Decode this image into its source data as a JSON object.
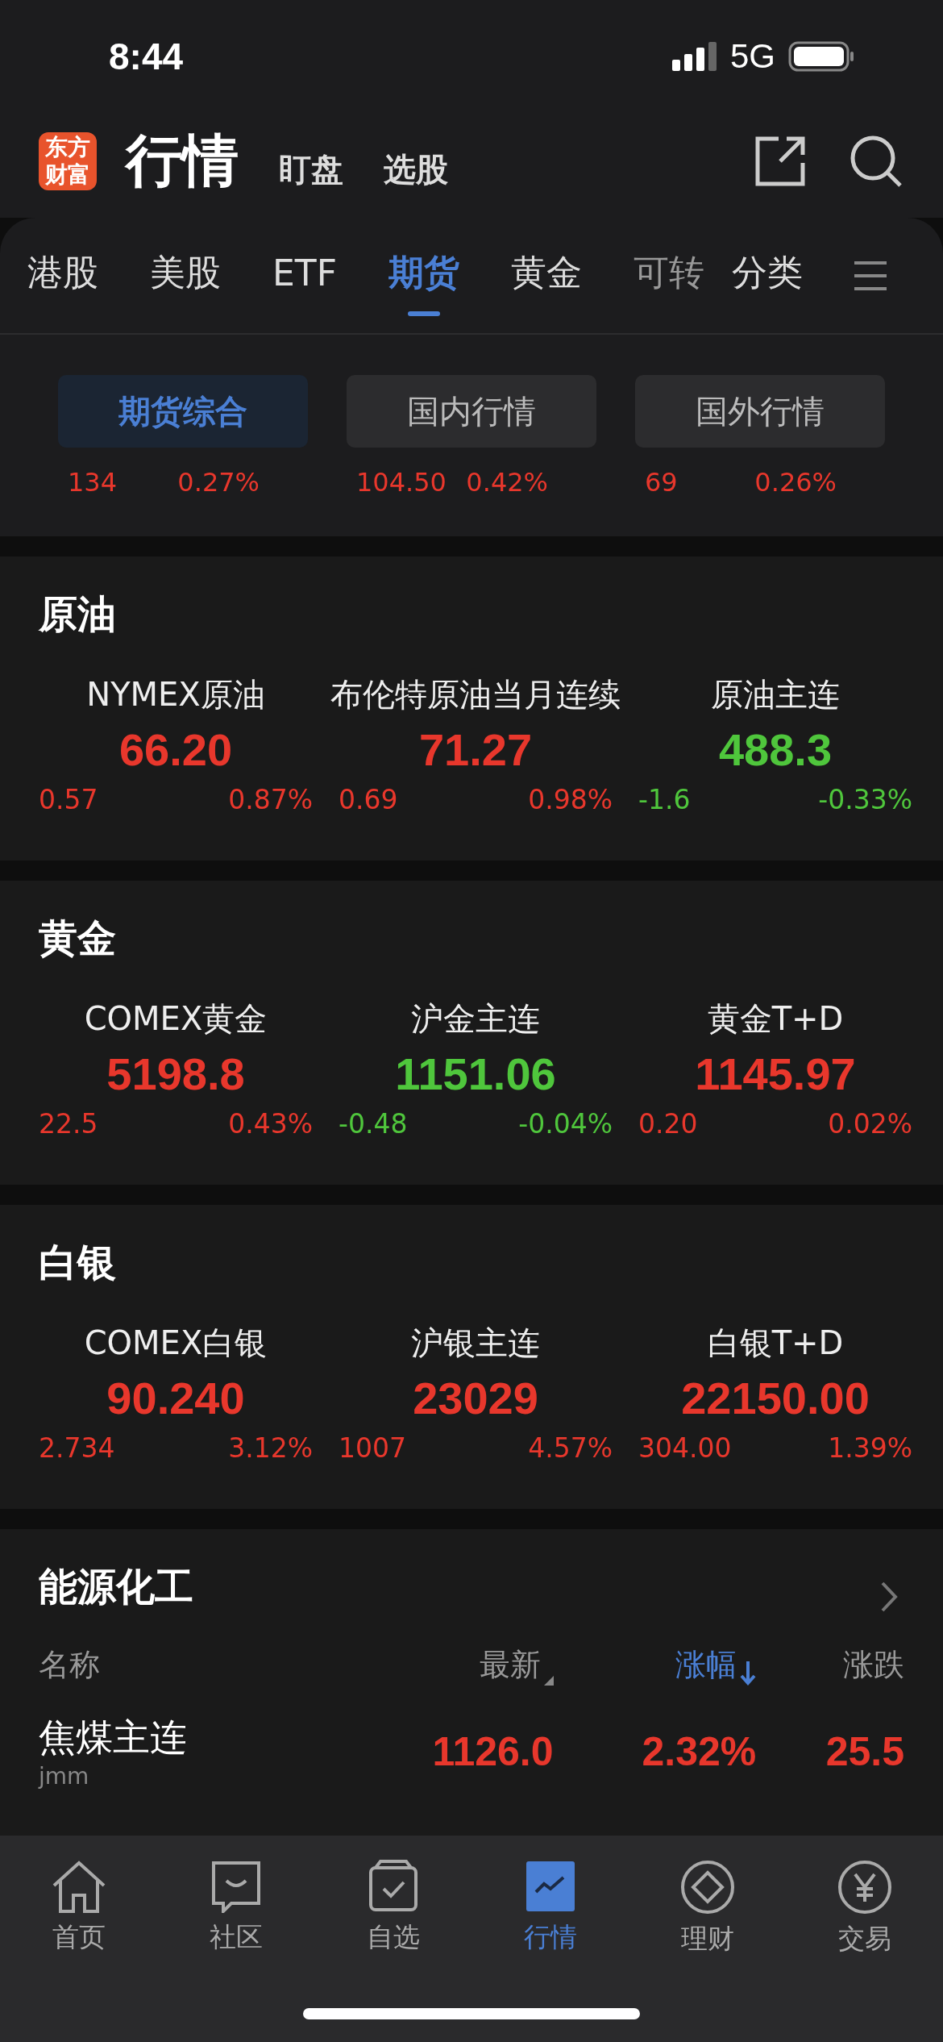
{
  "status_bar": {
    "time": "8:44",
    "network": "5G"
  },
  "header": {
    "logo": "东方财富",
    "title": "行情",
    "links": [
      "盯盘",
      "选股"
    ]
  },
  "tabs": [
    {
      "label": "港股",
      "selected": false
    },
    {
      "label": "美股",
      "selected": false
    },
    {
      "label": "ETF",
      "selected": false
    },
    {
      "label": "期货",
      "selected": true
    },
    {
      "label": "黄金",
      "selected": false
    },
    {
      "label": "可转",
      "selected": false
    },
    {
      "label": "分类",
      "selected": false
    }
  ],
  "markets": [
    {
      "label": "期货综合",
      "selected": true,
      "count": "134",
      "pct": "0.27%"
    },
    {
      "label": "国内行情",
      "selected": false,
      "count": "104.50",
      "pct": "0.42%"
    },
    {
      "label": "国外行情",
      "selected": false,
      "count": "69",
      "pct": "0.26%"
    }
  ],
  "sections": [
    {
      "title": "原油",
      "items": [
        {
          "name": "NYMEX原油",
          "price": "66.20",
          "change": "0.57",
          "pct": "0.87%",
          "kind": "up"
        },
        {
          "name": "布伦特原油当月连续",
          "price": "71.27",
          "change": "0.69",
          "pct": "0.98%",
          "kind": "up"
        },
        {
          "name": "原油主连",
          "price": "488.3",
          "change": "-1.6",
          "pct": "-0.33%",
          "kind": "down"
        }
      ]
    },
    {
      "title": "黄金",
      "items": [
        {
          "name": "COMEX黄金",
          "price": "5198.8",
          "change": "22.5",
          "pct": "0.43%",
          "kind": "up"
        },
        {
          "name": "沪金主连",
          "price": "1151.06",
          "change": "-0.48",
          "pct": "-0.04%",
          "kind": "down"
        },
        {
          "name": "黄金T+D",
          "price": "1145.97",
          "change": "0.20",
          "pct": "0.02%",
          "kind": "up"
        }
      ]
    },
    {
      "title": "白银",
      "items": [
        {
          "name": "COMEX白银",
          "price": "90.240",
          "change": "2.734",
          "pct": "3.12%",
          "kind": "up"
        },
        {
          "name": "沪银主连",
          "price": "23029",
          "change": "1007",
          "pct": "4.57%",
          "kind": "up"
        },
        {
          "name": "白银T+D",
          "price": "22150.00",
          "change": "304.00",
          "pct": "1.39%",
          "kind": "up"
        }
      ]
    }
  ],
  "energy": {
    "title": "能源化工",
    "columns": [
      {
        "label": "名称",
        "selected": false
      },
      {
        "label": "最新",
        "selected": false
      },
      {
        "label": "涨幅",
        "selected": true
      },
      {
        "label": "涨跌",
        "selected": false
      }
    ],
    "rows": [
      {
        "name": "焦煤主连",
        "code": "jmm",
        "price": "1126.0",
        "pct": "2.32%",
        "change": "25.5",
        "kind": "up"
      }
    ]
  },
  "nav": [
    {
      "label": "首页",
      "kind": "home",
      "selected": false
    },
    {
      "label": "社区",
      "kind": "chat",
      "selected": false
    },
    {
      "label": "自选",
      "kind": "check",
      "selected": false
    },
    {
      "label": "行情",
      "kind": "chart",
      "selected": true
    },
    {
      "label": "理财",
      "kind": "diamond",
      "selected": false
    },
    {
      "label": "交易",
      "kind": "yen",
      "selected": false
    }
  ]
}
